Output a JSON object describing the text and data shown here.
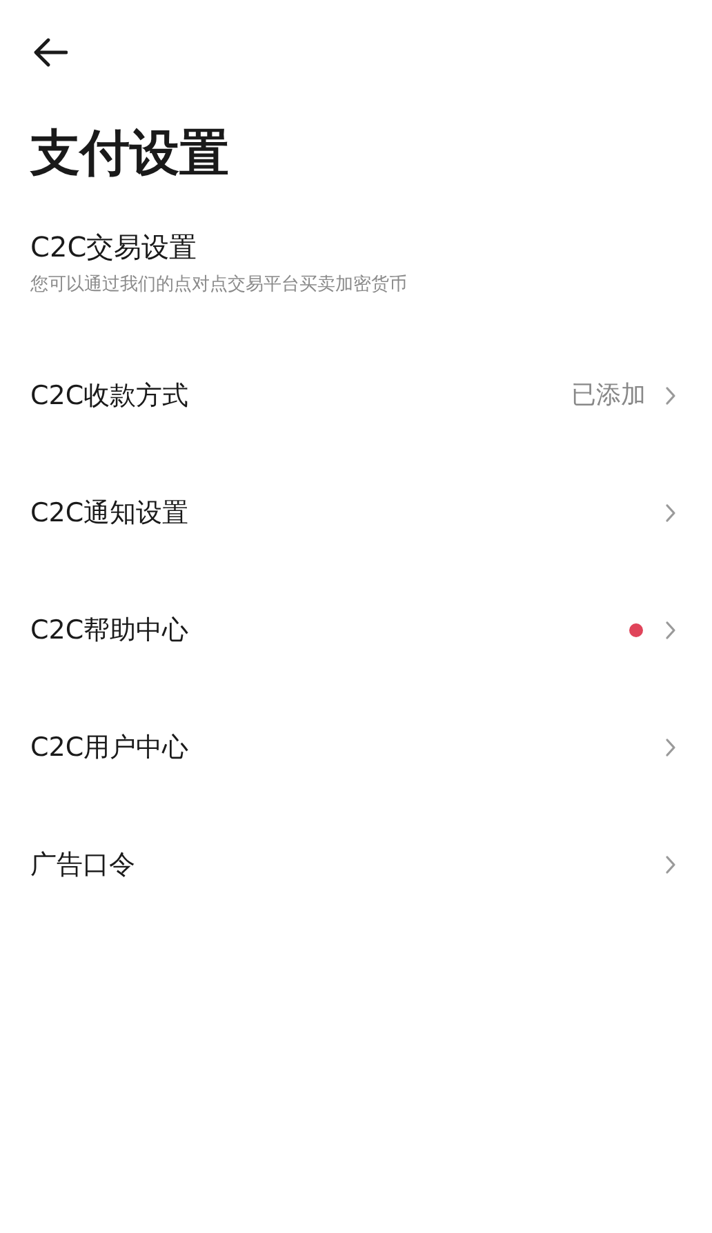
{
  "title": "支付设置",
  "section": {
    "title": "C2C交易设置",
    "description": "您可以通过我们的点对点交易平台买卖加密货币"
  },
  "items": [
    {
      "label": "C2C收款方式",
      "value": "已添加",
      "notification_dot": false
    },
    {
      "label": "C2C通知设置",
      "notification_dot": false
    },
    {
      "label": "C2C帮助中心",
      "notification_dot": true
    },
    {
      "label": "C2C用户中心",
      "notification_dot": false
    },
    {
      "label": "广告口令",
      "notification_dot": false
    }
  ]
}
